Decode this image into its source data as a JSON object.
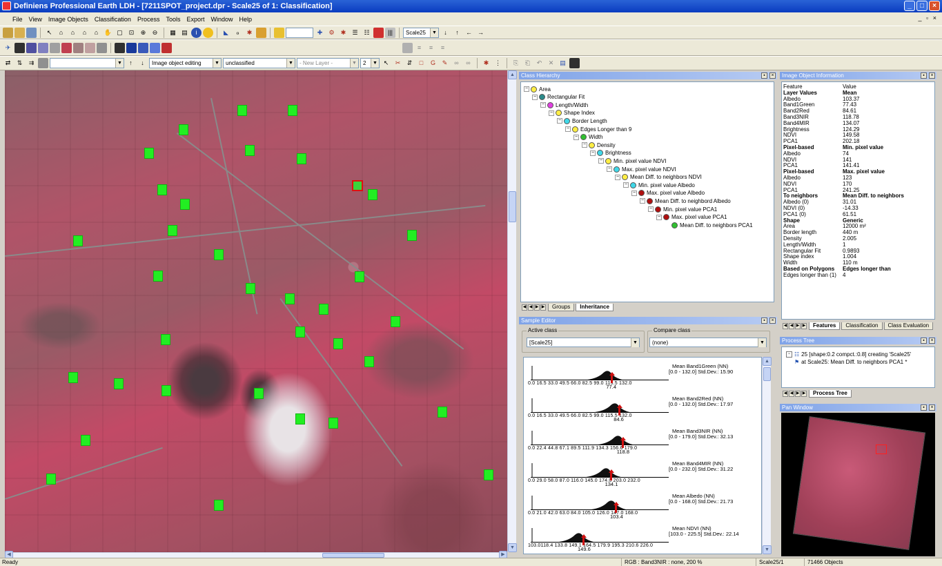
{
  "window": {
    "title": "Definiens Professional Earth LDH - [7211SPOT_project.dpr - Scale25 of 1: Classification]"
  },
  "menu": [
    "File",
    "View",
    "Image Objects",
    "Classification",
    "Process",
    "Tools",
    "Export",
    "Window",
    "Help"
  ],
  "toolbar": {
    "scale_combo": "Scale25",
    "mode_combo": "Image object editing",
    "class_combo": "unclassified",
    "layer_combo": "- New Layer -",
    "level_combo": "2"
  },
  "class_hierarchy": {
    "title": "Class Hierarchy",
    "nodes": [
      {
        "label": "Area",
        "color": "#ffee44"
      },
      {
        "label": "Rectangular Fit",
        "color": "#2a8a8a"
      },
      {
        "label": "Length/Width",
        "color": "#e040e0"
      },
      {
        "label": "Shape Index",
        "color": "#ffee44"
      },
      {
        "label": "Border Length",
        "color": "#40d8e8"
      },
      {
        "label": "Edges Longer than 9",
        "color": "#ffee44"
      },
      {
        "label": "Width",
        "color": "#30c030"
      },
      {
        "label": "Density",
        "color": "#ffee44"
      },
      {
        "label": "Brightness",
        "color": "#40d8e8"
      },
      {
        "label": "Min. pixel value NDVI",
        "color": "#ffee44"
      },
      {
        "label": "Max. pixel value NDVI",
        "color": "#40d8e8"
      },
      {
        "label": "Mean Diff. to neighbors NDVI",
        "color": "#ffee44"
      },
      {
        "label": "Min. pixel value Albedo",
        "color": "#40d8e8"
      },
      {
        "label": "Max. pixel value Albedo",
        "color": "#b01010"
      },
      {
        "label": "Mean Diff. to neighbord Albedo",
        "color": "#b01010"
      },
      {
        "label": "Min. pixel value PCA1",
        "color": "#b01010"
      },
      {
        "label": "Max. pixel value PCA1",
        "color": "#b01010"
      },
      {
        "label": "Mean Diff. to neighbors PCA1",
        "color": "#30c030"
      }
    ],
    "tabs": [
      "Groups",
      "Inheritance"
    ]
  },
  "image_object_info": {
    "title": "Image Object Information",
    "col_feature": "Feature",
    "col_value": "Value",
    "rows": [
      {
        "k": "Layer Values",
        "v": "Mean",
        "h": true
      },
      {
        "k": "Albedo",
        "v": "103.37"
      },
      {
        "k": "Band1Green",
        "v": "77.43"
      },
      {
        "k": "Band2Red",
        "v": "84.61"
      },
      {
        "k": "Band3NIR",
        "v": "118.78"
      },
      {
        "k": "Band4MIR",
        "v": "134.07"
      },
      {
        "k": "Brightness",
        "v": "124.29"
      },
      {
        "k": "NDVI",
        "v": "149.58"
      },
      {
        "k": "PCA1",
        "v": "202.18"
      },
      {
        "k": "Pixel-based",
        "v": "Min. pixel value",
        "h": true
      },
      {
        "k": "Albedo",
        "v": "74"
      },
      {
        "k": "NDVI",
        "v": "141"
      },
      {
        "k": "PCA1",
        "v": "141.41"
      },
      {
        "k": "Pixel-based",
        "v": "Max. pixel value",
        "h": true
      },
      {
        "k": "Albedo",
        "v": "123"
      },
      {
        "k": "NDVI",
        "v": "170"
      },
      {
        "k": "PCA1",
        "v": "241.25"
      },
      {
        "k": "To neighbors",
        "v": "Mean Diff. to neighbors",
        "h": true
      },
      {
        "k": "Albedo (0)",
        "v": "31.01"
      },
      {
        "k": "NDVI (0)",
        "v": "-14.33"
      },
      {
        "k": "PCA1 (0)",
        "v": "61.51"
      },
      {
        "k": "Shape",
        "v": "Generic",
        "h": true
      },
      {
        "k": "Area",
        "v": "12000 m²"
      },
      {
        "k": "Border length",
        "v": "440 m"
      },
      {
        "k": "Density",
        "v": "2.005"
      },
      {
        "k": "Length/Width",
        "v": "1"
      },
      {
        "k": "Rectangular Fit",
        "v": "0.9893"
      },
      {
        "k": "Shape index",
        "v": "1.004"
      },
      {
        "k": "Width",
        "v": "110 m"
      },
      {
        "k": "Based on Polygons",
        "v": "Edges longer than",
        "h": true
      },
      {
        "k": "Edges longer than (1)",
        "v": "4"
      }
    ],
    "tabs": [
      "Features",
      "Classification",
      "Class Evaluation"
    ]
  },
  "sample_editor": {
    "title": "Sample Editor",
    "active_label": "Active class",
    "active_value": "[Scale25]",
    "compare_label": "Compare class",
    "compare_value": "(none)",
    "hists": [
      {
        "name": "Mean Band1Green (NN)",
        "range": "[0.0 - 132.0] Std.Dev.: 15.90",
        "ticks": "0.0    16.5    33.0    49.5    66.0    82.5    99.0   115.5  132.0",
        "mark": "77.4",
        "pos": 0.587
      },
      {
        "name": "Mean Band2Red (NN)",
        "range": "[0.0 - 132.0] Std.Dev.: 17.97",
        "ticks": "0.0    16.5    33.0    49.5    66.0    82.5    99.0   115.5  132.0",
        "mark": "84.6",
        "pos": 0.641
      },
      {
        "name": "Mean Band3NIR (NN)",
        "range": "[0.0 - 179.0] Std.Dev.: 32.13",
        "ticks": "0.0    22.4    44.8    67.1    89.5   111.9  134.3  156.6  179.0",
        "mark": "118.8",
        "pos": 0.664
      },
      {
        "name": "Mean Band4MIR (NN)",
        "range": "[0.0 - 232.0] Std.Dev.: 31.22",
        "ticks": "0.0    29.0    58.0    87.0   116.0  145.0  174.0  203.0  232.0",
        "mark": "134.1",
        "pos": 0.578
      },
      {
        "name": "Mean Albedo (NN)",
        "range": "[0.0 - 168.0] Std.Dev.: 21.73",
        "ticks": "0.0    21.0    42.0    63.0    84.0   105.0  126.0  147.0  168.0",
        "mark": "103.4",
        "pos": 0.615
      },
      {
        "name": "Mean NDVI (NN)",
        "range": "[103.0 - 225.5] Std.Dev.: 22.14",
        "ticks": "103.0118.4  133.8  149.1  164.5  179.9  195.3  210.6  226.0",
        "mark": "149.6",
        "pos": 0.38
      }
    ]
  },
  "process_tree": {
    "title": "Process Tree",
    "line1": "25 [shape:0.2 compct.:0.8] creating 'Scale25'",
    "line2": "at Scale25: Mean Diff. to neighbors PCA1 *",
    "tab": "Process Tree"
  },
  "pan_window": {
    "title": "Pan Window"
  },
  "status": {
    "ready": "Ready",
    "rgb": "RGB : Band3NIR : none, 200 %",
    "level": "Scale25/1",
    "objects": "71466 Objects"
  },
  "colors": {
    "segment": "#22ee22",
    "selection": "#e01010",
    "titlebar": "#0a3cc0"
  }
}
